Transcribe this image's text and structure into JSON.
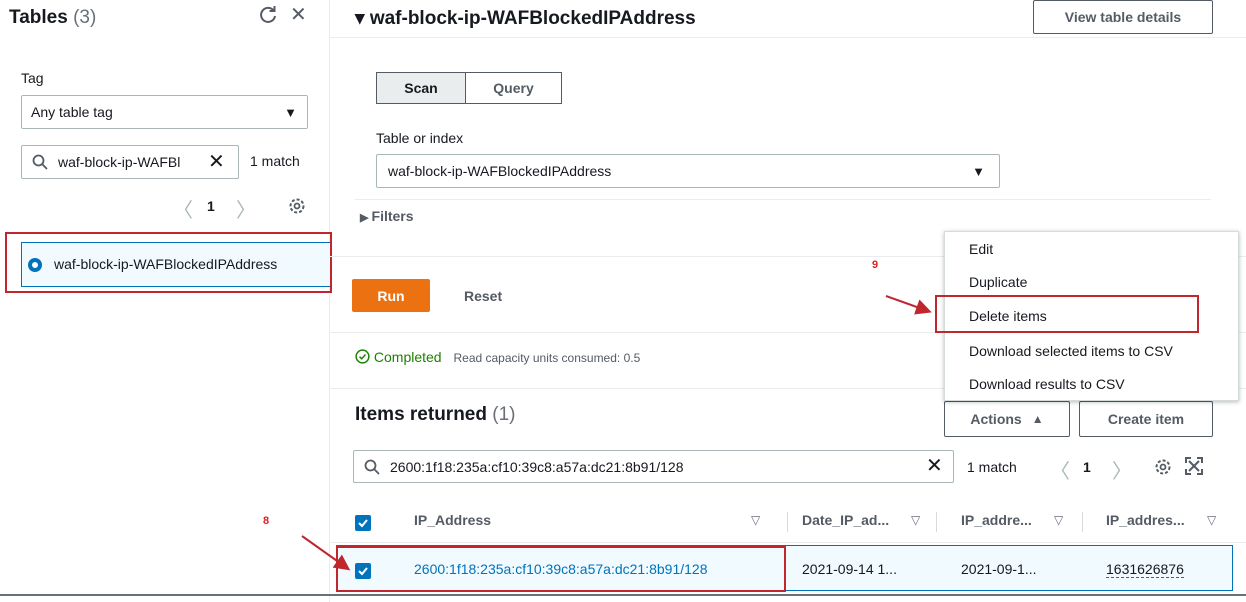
{
  "left_panel": {
    "title": "Tables",
    "count": "(3)",
    "tag_label": "Tag",
    "tag_value": "Any table tag",
    "search_value": "waf-block-ip-WAFBl­",
    "match_text": "1 match",
    "page": "1",
    "selected_table": "waf-block-ip-WAFBlockedIPAddress"
  },
  "main": {
    "table_name": "waf-block-ip-WAFBlockedIPAddress",
    "view_details_label": "View table details",
    "scan_label": "Scan",
    "query_label": "Query",
    "index_label": "Table or index",
    "index_value": "waf-block-ip-WAFBlockedIPAddress",
    "filters_label": "Filters",
    "run_label": "Run",
    "reset_label": "Reset",
    "status_text": "Completed",
    "status_detail": "Read capacity units consumed: 0.5"
  },
  "items": {
    "title": "Items returned",
    "count": "(1)",
    "actions_label": "Actions",
    "create_label": "Create item",
    "search_value": "2600:1f18:235a:cf10:39c8:a57a:dc21:8b91/128",
    "match_text": "1 match",
    "page": "1",
    "columns": [
      "IP_Address",
      "Date_IP_ad...",
      "IP_addre...",
      "IP_addres..."
    ],
    "row": [
      "2600:1f18:235a:cf10:39c8:a57a:dc21:8b91/128",
      "2021-09-14 1...",
      "2021-09-1...",
      "1631626876"
    ]
  },
  "actions_menu": [
    "Edit",
    "Duplicate",
    "Delete items",
    "Download selected items to CSV",
    "Download results to CSV"
  ],
  "annotations": {
    "step_8": "8",
    "step_9": "9"
  },
  "colors": {
    "accent": "#0073bb",
    "run": "#ec7211",
    "success": "#1d8102",
    "highlight": "#c0262e"
  }
}
